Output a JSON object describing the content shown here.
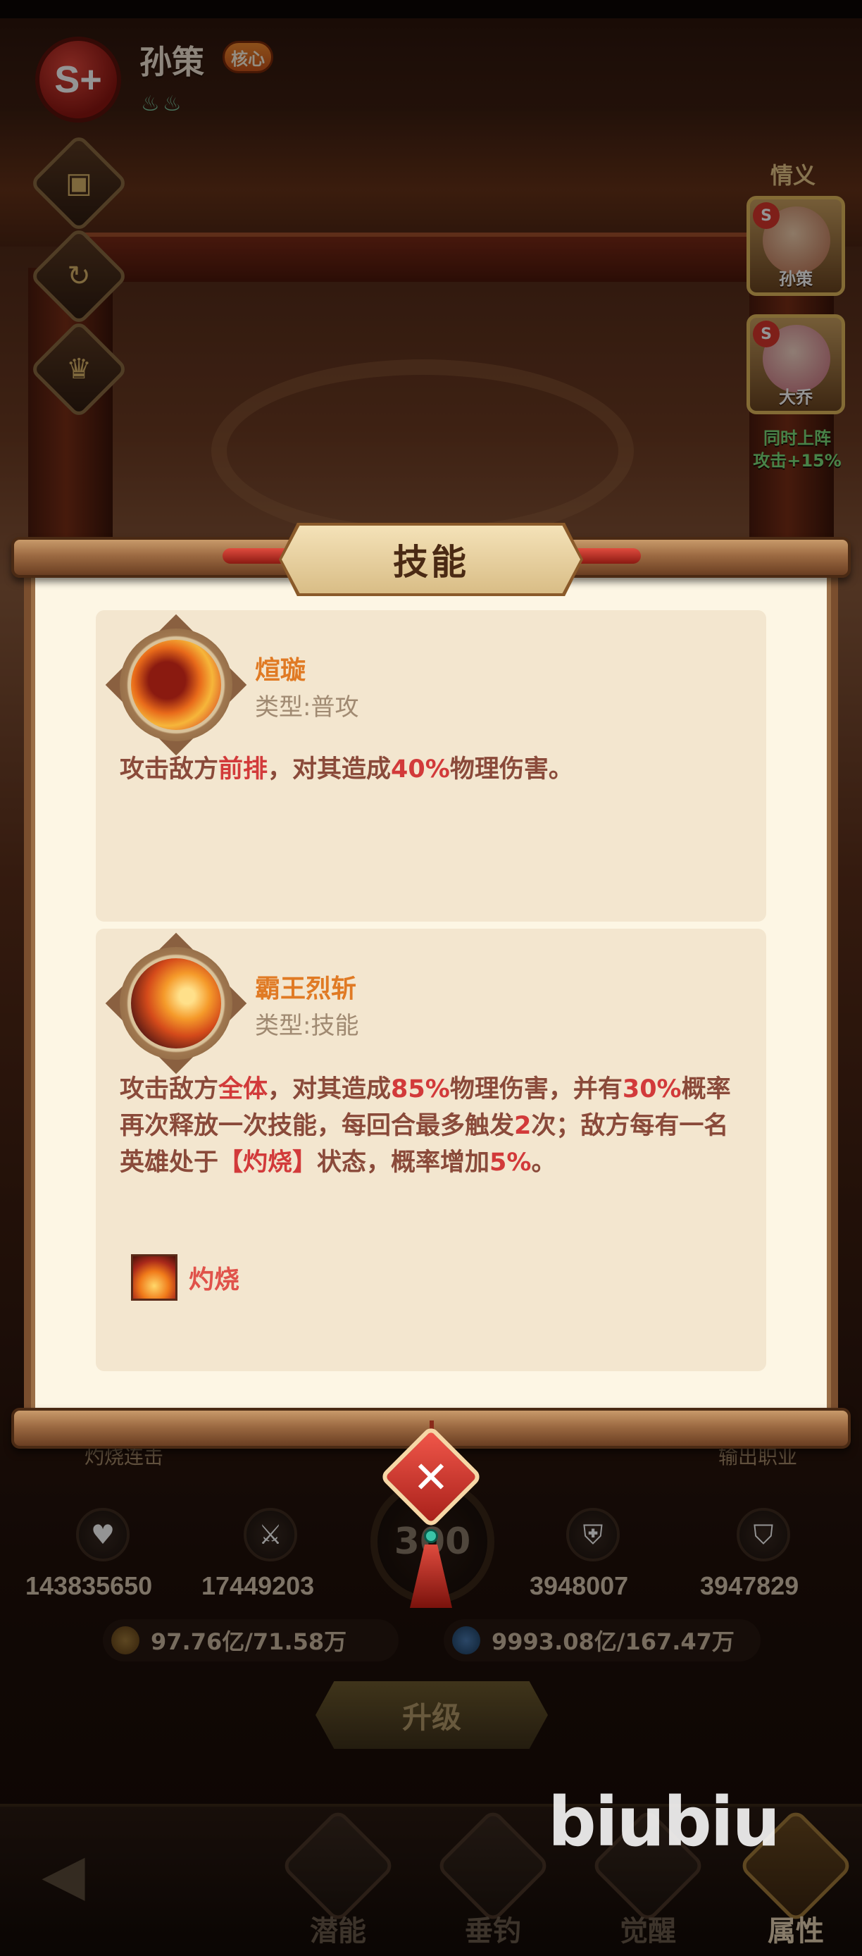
{
  "hero": {
    "rank": "S+",
    "name": "孙策",
    "core_badge": "核心"
  },
  "bond": {
    "title": "情义",
    "partners": [
      {
        "rank": "S",
        "name": "孙策"
      },
      {
        "rank": "S",
        "name": "大乔"
      }
    ],
    "effect_line1": "同时上阵",
    "effect_line2": "攻击+15%"
  },
  "modal": {
    "title": "技能",
    "skills": [
      {
        "name": "煊璇",
        "type": "类型:普攻",
        "desc": [
          {
            "t": "攻击敌方",
            "hl": false
          },
          {
            "t": "前排",
            "hl": true
          },
          {
            "t": "，对其造成",
            "hl": false
          },
          {
            "t": "40%",
            "hl": true
          },
          {
            "t": "物理伤害。",
            "hl": false
          }
        ]
      },
      {
        "name": "霸王烈斩",
        "type": "类型:技能",
        "desc": [
          {
            "t": "攻击敌方",
            "hl": false
          },
          {
            "t": "全体",
            "hl": true
          },
          {
            "t": "，对其造成",
            "hl": false
          },
          {
            "t": "85%",
            "hl": true
          },
          {
            "t": "物理伤害，并有",
            "hl": false
          },
          {
            "t": "30%",
            "hl": true
          },
          {
            "t": "概率再次释放一次技能，每回合最多触发",
            "hl": false
          },
          {
            "t": "2",
            "hl": true
          },
          {
            "t": "次；敌方每有一名英雄处于",
            "hl": false
          },
          {
            "t": "【灼烧】",
            "hl": true
          },
          {
            "t": "状态，概率增加",
            "hl": false
          },
          {
            "t": "5%",
            "hl": true
          },
          {
            "t": "。",
            "hl": false
          }
        ],
        "status_effect": "灼烧"
      }
    ]
  },
  "stats": {
    "hp": "143835650",
    "attack": "17449203",
    "level": "300",
    "defense": "3948007",
    "magic_defense": "3947829",
    "gold": "97.76亿/71.58万",
    "exp": "9993.08亿/167.47万",
    "feature_left": "灼烧连击",
    "feature_right": "输出职业"
  },
  "upgrade_label": "升级",
  "nav": {
    "items": [
      "潜能",
      "垂钓",
      "觉醒",
      "属性"
    ],
    "active": "属性"
  },
  "watermark": "biubiu",
  "colors": {
    "highlight": "#d23a3a",
    "skill_name": "#e07a24",
    "bond_green": "#7ce07c"
  }
}
